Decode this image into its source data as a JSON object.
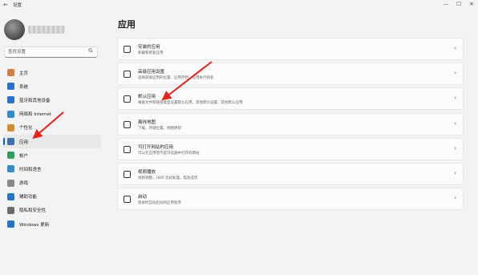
{
  "window": {
    "title": "设置",
    "back_glyph": "←",
    "minimize_glyph": "—",
    "maximize_glyph": "☐",
    "close_glyph": "✕"
  },
  "sidebar": {
    "search_placeholder": "查找设置",
    "search_icon": "search-icon",
    "items": [
      {
        "label": "主页",
        "icon": "home-icon",
        "color": "#e07a3a"
      },
      {
        "label": "系统",
        "icon": "system-icon",
        "color": "#1f75d1"
      },
      {
        "label": "蓝牙和其他设备",
        "icon": "bluetooth-icon",
        "color": "#1f75d1"
      },
      {
        "label": "网络和 Internet",
        "icon": "network-icon",
        "color": "#2a8fd6"
      },
      {
        "label": "个性化",
        "icon": "brush-icon",
        "color": "#d88a2b"
      },
      {
        "label": "应用",
        "icon": "apps-icon",
        "color": "#3a6fb5",
        "active": true
      },
      {
        "label": "帐户",
        "icon": "account-icon",
        "color": "#2aa35a"
      },
      {
        "label": "时间和语言",
        "icon": "time-language-icon",
        "color": "#2a8fd6"
      },
      {
        "label": "游戏",
        "icon": "gaming-icon",
        "color": "#8a8a8a"
      },
      {
        "label": "辅助功能",
        "icon": "accessibility-icon",
        "color": "#1f75d1"
      },
      {
        "label": "隐私和安全性",
        "icon": "shield-icon",
        "color": "#6b6b6b"
      },
      {
        "label": "Windows 更新",
        "icon": "update-icon",
        "color": "#1f75d1"
      }
    ]
  },
  "main": {
    "title": "应用",
    "cards": [
      {
        "title": "安装的应用",
        "desc": "卸载和修复应用",
        "icon": "installed-apps-icon"
      },
      {
        "title": "高级应用设置",
        "desc": "选择获取应用的位置、应用存档、应用执行别名",
        "icon": "advanced-settings-icon"
      },
      {
        "title": "默认应用",
        "desc": "根据文件和链接类型设置默认应用，其他默认设置，其他默认应用",
        "icon": "default-apps-icon"
      },
      {
        "title": "离线地图",
        "desc": "下载，存储位置，地图更新",
        "icon": "offline-maps-icon"
      },
      {
        "title": "可打开网站的应用",
        "desc": "可以在应用而不是浏览器中打开的网站",
        "icon": "apps-for-websites-icon"
      },
      {
        "title": "视频播放",
        "desc": "视频调整，HDR 流式处理，电池选项",
        "icon": "video-playback-icon"
      },
      {
        "title": "启动",
        "desc": "登录时自动启动的应用程序",
        "icon": "startup-icon"
      }
    ],
    "chevron": "›"
  },
  "annotations": {
    "arrow_color": "#e8211b"
  }
}
